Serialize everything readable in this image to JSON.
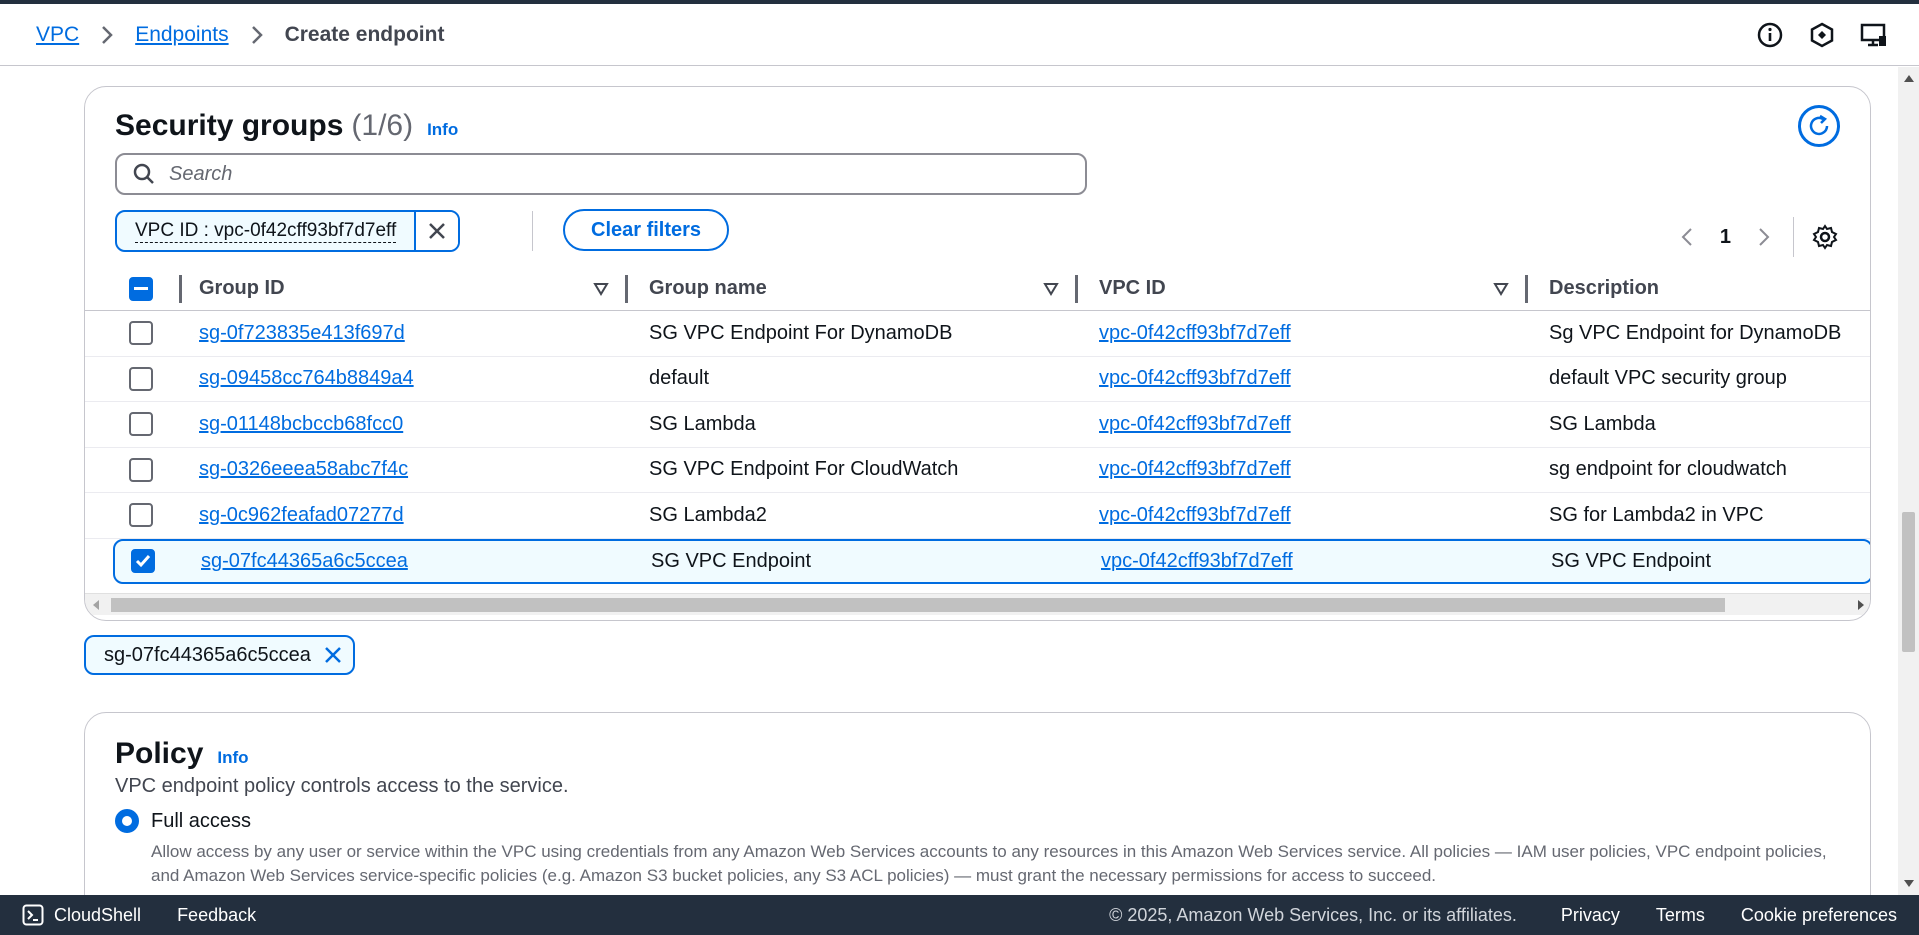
{
  "breadcrumb": {
    "items": [
      "VPC",
      "Endpoints"
    ],
    "current": "Create endpoint"
  },
  "header_icons": [
    "info-circle-icon",
    "hexagon-settings-icon",
    "monitor-icon"
  ],
  "security_groups": {
    "title": "Security groups",
    "count": "(1/6)",
    "info": "Info",
    "search_placeholder": "Search",
    "filter_token": "VPC ID : vpc-0f42cff93bf7d7eff",
    "clear_filters": "Clear filters",
    "page": "1",
    "columns": [
      "Group ID",
      "Group name",
      "VPC ID",
      "Description"
    ],
    "rows": [
      {
        "group_id": "sg-0f723835e413f697d",
        "group_name": "SG VPC Endpoint For DynamoDB",
        "vpc_id": "vpc-0f42cff93bf7d7eff",
        "description": "Sg VPC Endpoint for DynamoDB",
        "selected": false
      },
      {
        "group_id": "sg-09458cc764b8849a4",
        "group_name": "default",
        "vpc_id": "vpc-0f42cff93bf7d7eff",
        "description": "default VPC security group",
        "selected": false
      },
      {
        "group_id": "sg-01148bcbccb68fcc0",
        "group_name": "SG Lambda",
        "vpc_id": "vpc-0f42cff93bf7d7eff",
        "description": "SG Lambda",
        "selected": false
      },
      {
        "group_id": "sg-0326eeea58abc7f4c",
        "group_name": "SG VPC Endpoint For CloudWatch",
        "vpc_id": "vpc-0f42cff93bf7d7eff",
        "description": "sg endpoint for cloudwatch",
        "selected": false
      },
      {
        "group_id": "sg-0c962feafad07277d",
        "group_name": "SG Lambda2",
        "vpc_id": "vpc-0f42cff93bf7d7eff",
        "description": "SG for Lambda2 in VPC",
        "selected": false
      },
      {
        "group_id": "sg-07fc44365a6c5ccea",
        "group_name": "SG VPC Endpoint",
        "vpc_id": "vpc-0f42cff93bf7d7eff",
        "description": "SG VPC Endpoint",
        "selected": true
      }
    ],
    "selected_token": "sg-07fc44365a6c5ccea"
  },
  "policy": {
    "title": "Policy",
    "info": "Info",
    "description": "VPC endpoint policy controls access to the service.",
    "option_label": "Full access",
    "option_description": "Allow access by any user or service within the VPC using credentials from any Amazon Web Services accounts to any resources in this Amazon Web Services service. All policies — IAM user policies, VPC endpoint policies, and Amazon Web Services service-specific policies (e.g. Amazon S3 bucket policies, any S3 ACL policies) — must grant the necessary permissions for access to succeed."
  },
  "footer": {
    "cloudshell": "CloudShell",
    "feedback": "Feedback",
    "copyright": "© 2025, Amazon Web Services, Inc. or its affiliates.",
    "privacy": "Privacy",
    "terms": "Terms",
    "cookies": "Cookie preferences"
  },
  "colors": {
    "accent": "#006ce0",
    "footer_bg": "#232f3e",
    "selected_bg": "#f0fbff"
  }
}
